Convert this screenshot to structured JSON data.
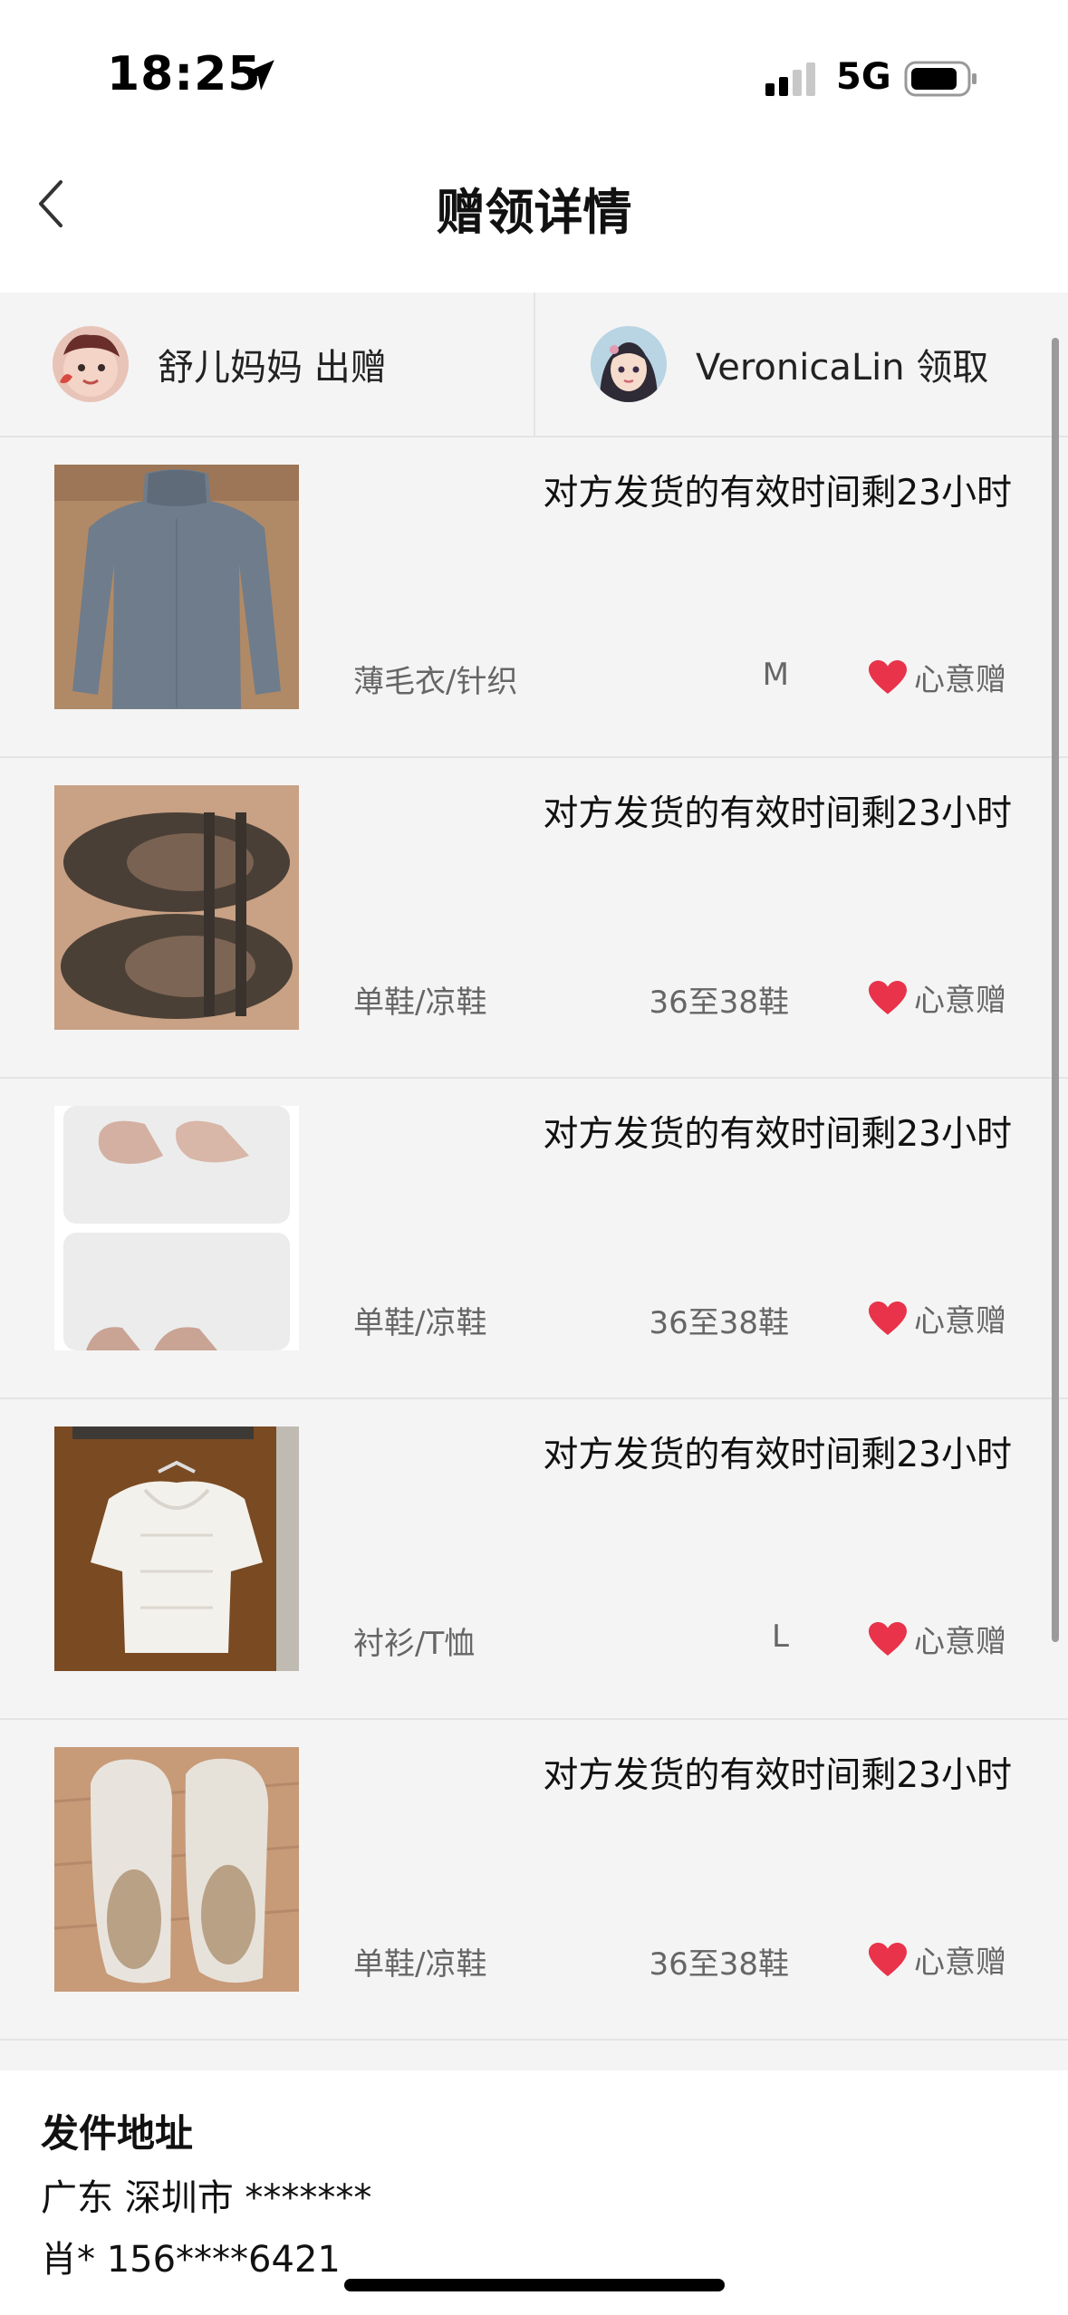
{
  "status_bar": {
    "time": "18:25",
    "network": "5G"
  },
  "header": {
    "title": "赠领详情"
  },
  "users": {
    "giver": {
      "label": "舒儿妈妈 出赠"
    },
    "receiver": {
      "label": "VeronicaLin 领取"
    }
  },
  "items": [
    {
      "deadline": "对方发货的有效时间剩23小时",
      "category": "薄毛衣/针织",
      "size": "M",
      "tag": "心意赠"
    },
    {
      "deadline": "对方发货的有效时间剩23小时",
      "category": "单鞋/凉鞋",
      "size": "36至38鞋",
      "tag": "心意赠"
    },
    {
      "deadline": "对方发货的有效时间剩23小时",
      "category": "单鞋/凉鞋",
      "size": "36至38鞋",
      "tag": "心意赠"
    },
    {
      "deadline": "对方发货的有效时间剩23小时",
      "category": "衬衫/T恤",
      "size": "L",
      "tag": "心意赠"
    },
    {
      "deadline": "对方发货的有效时间剩23小时",
      "category": "单鞋/凉鞋",
      "size": "36至38鞋",
      "tag": "心意赠"
    }
  ],
  "address": {
    "title": "发件地址",
    "line1": "广东 深圳市 *******",
    "line2": "肖* 156****6421"
  },
  "icons": [
    "location-arrow-icon",
    "signal-icon",
    "battery-icon",
    "back-chevron-icon",
    "heart-icon"
  ],
  "colors": {
    "heart": "#e8334a",
    "background": "#f4f4f4"
  }
}
